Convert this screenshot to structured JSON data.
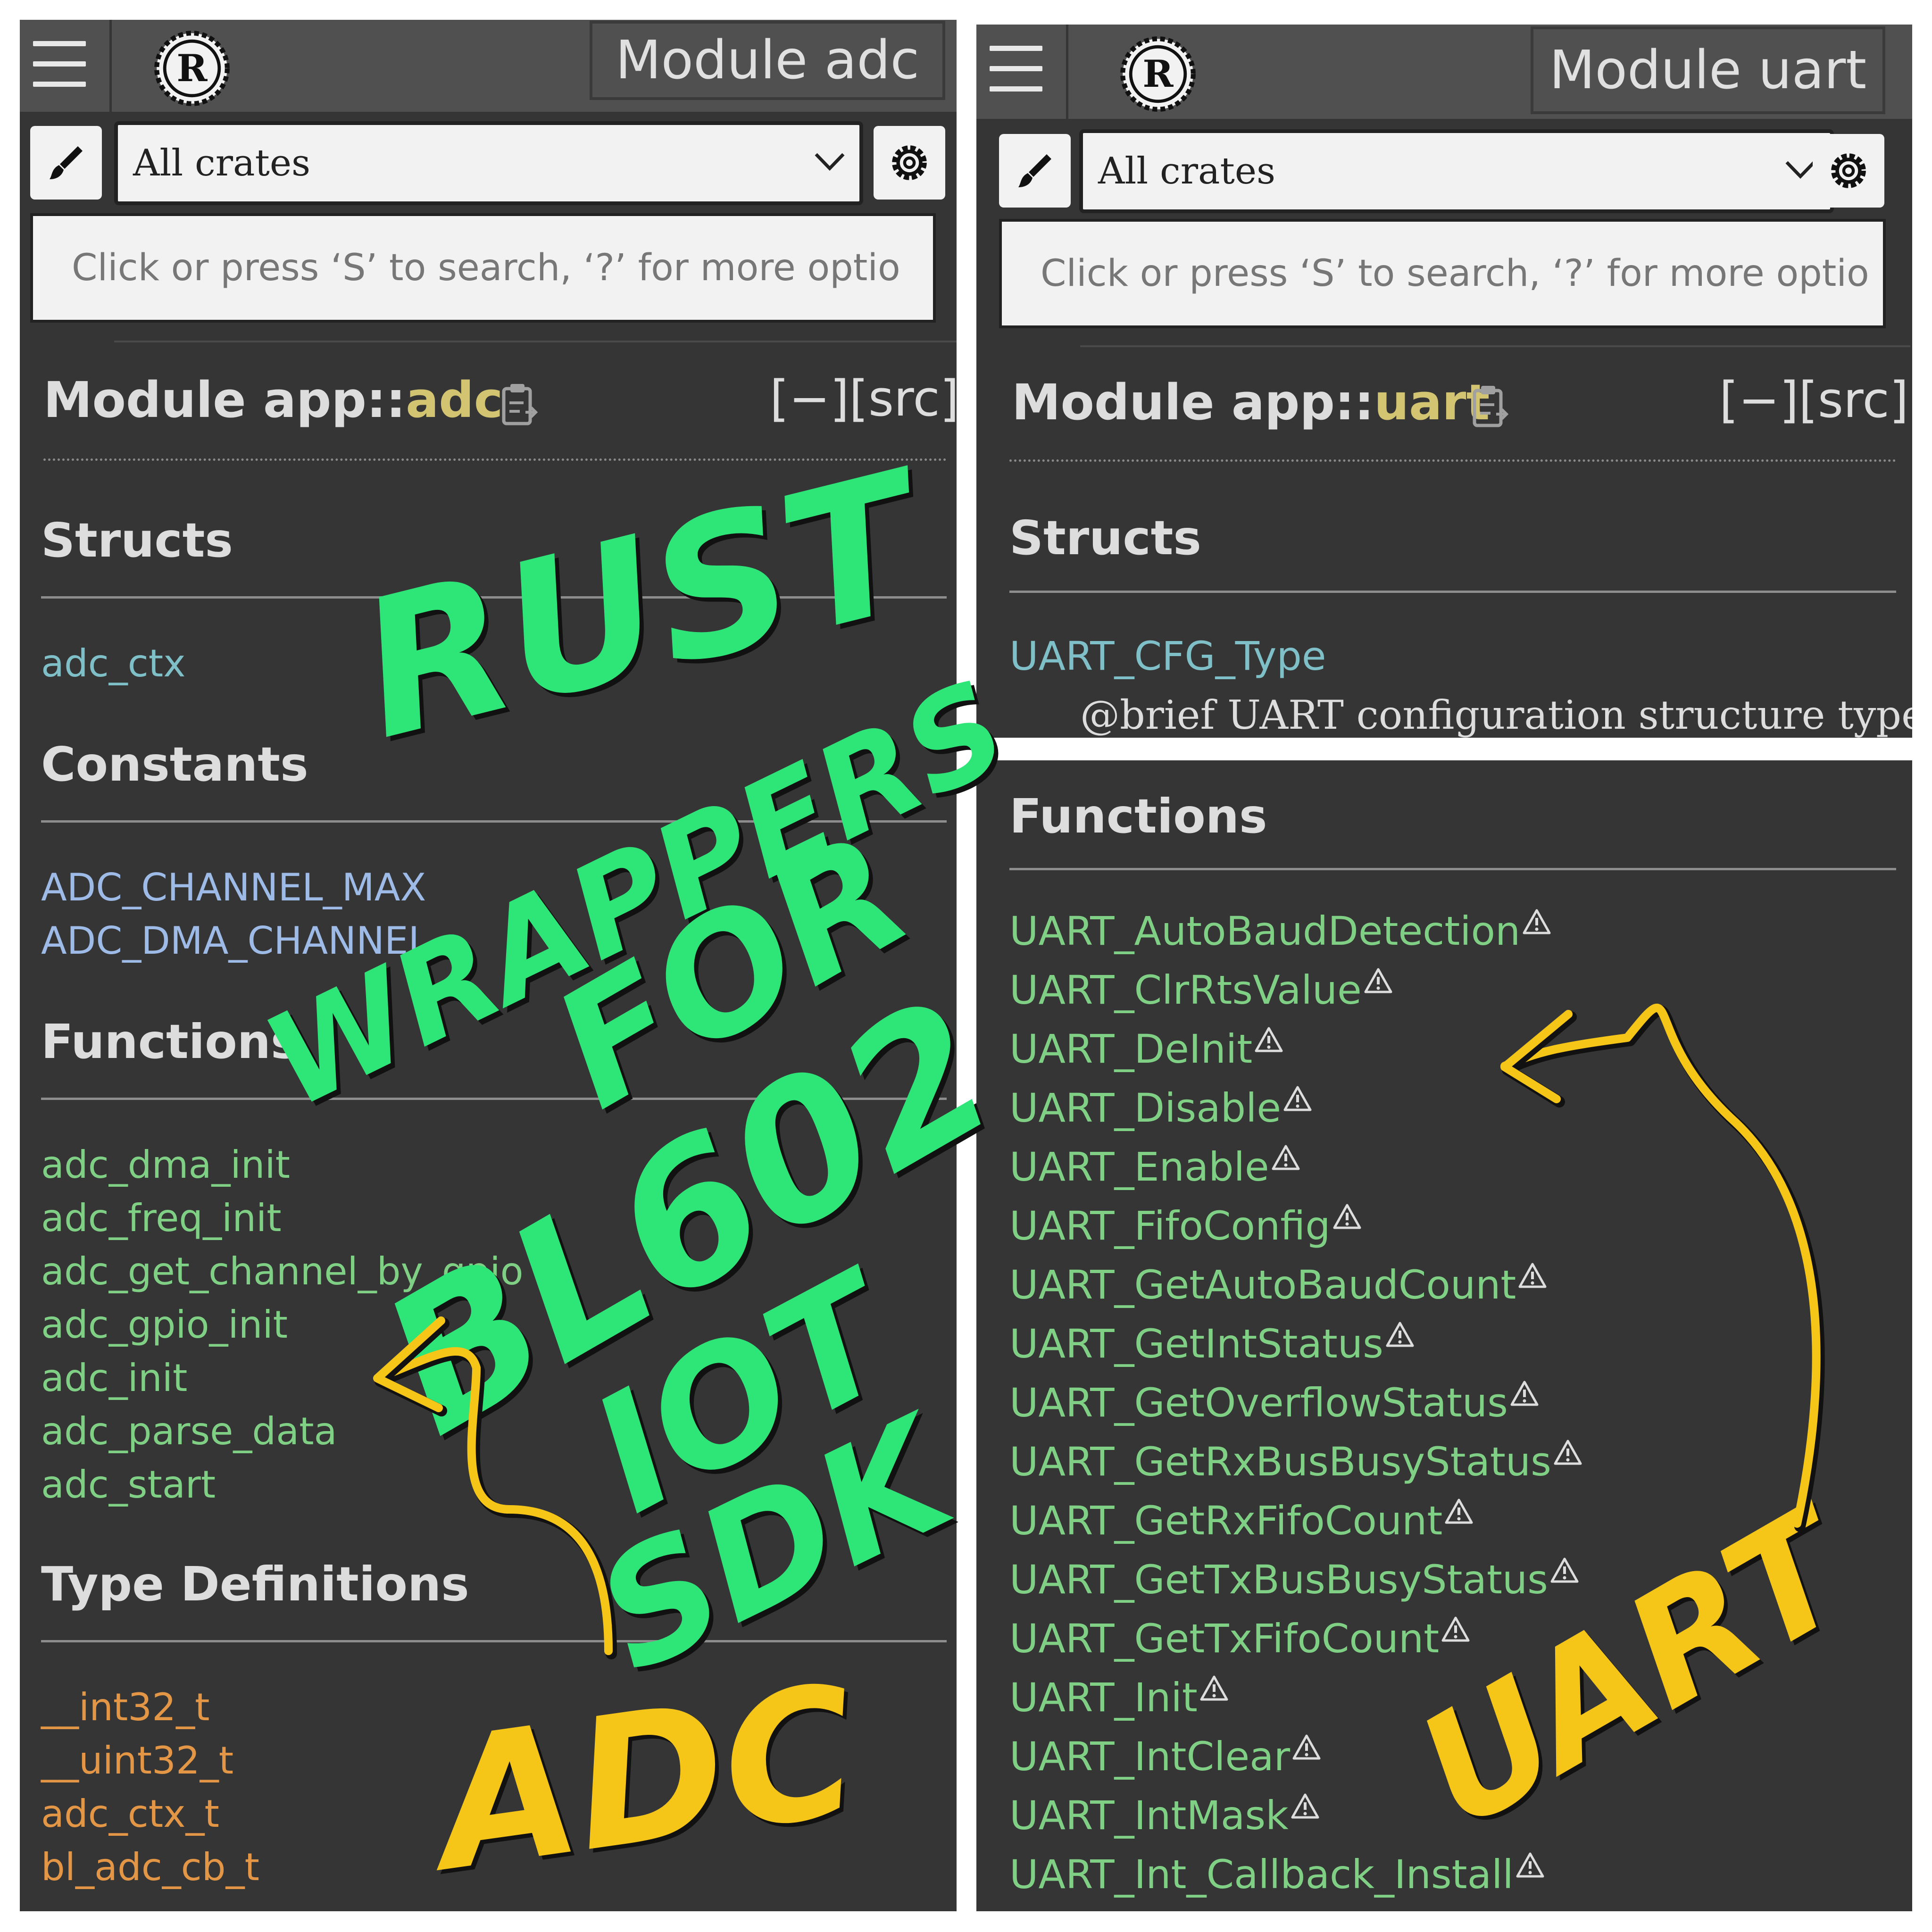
{
  "adc_panel": {
    "title_box": "Module adc",
    "crate_select": "All crates",
    "search_placeholder": "Click or press ‘S’ to search, ‘?’ for more optio",
    "heading_prefix": "Module app::",
    "heading_module": "adc",
    "src_links": "[−][src]",
    "sections": {
      "structs": {
        "title": "Structs",
        "items": [
          "adc_ctx"
        ]
      },
      "constants": {
        "title": "Constants",
        "items": [
          "ADC_CHANNEL_MAX",
          "ADC_DMA_CHANNEL"
        ]
      },
      "functions": {
        "title": "Functions",
        "items": [
          "adc_dma_init",
          "adc_freq_init",
          "adc_get_channel_by_gpio",
          "adc_gpio_init",
          "adc_init",
          "adc_parse_data",
          "adc_start"
        ]
      },
      "typedefs": {
        "title": "Type Definitions",
        "items": [
          "__int32_t",
          "__uint32_t",
          "adc_ctx_t",
          "bl_adc_cb_t"
        ]
      }
    }
  },
  "uart_panel": {
    "title_box": "Module uart",
    "crate_select": "All crates",
    "search_placeholder": "Click or press ‘S’ to search, ‘?’ for more optio",
    "heading_prefix": "Module app::",
    "heading_module": "uart",
    "src_links": "[−][src]",
    "structs": {
      "title": "Structs",
      "items": [
        {
          "name": "UART_CFG_Type",
          "doc": "@brief UART configuration structure type"
        }
      ]
    },
    "functions": {
      "title": "Functions",
      "items": [
        "UART_AutoBaudDetection",
        "UART_ClrRtsValue",
        "UART_DeInit",
        "UART_Disable",
        "UART_Enable",
        "UART_FifoConfig",
        "UART_GetAutoBaudCount",
        "UART_GetIntStatus",
        "UART_GetOverflowStatus",
        "UART_GetRxBusBusyStatus",
        "UART_GetRxFifoCount",
        "UART_GetTxBusBusyStatus",
        "UART_GetTxFifoCount",
        "UART_Init",
        "UART_IntClear",
        "UART_IntMask",
        "UART_Int_Callback_Install"
      ]
    }
  },
  "annotations": {
    "headline_lines": [
      "RUST",
      "WRAPPERS",
      "FOR",
      "BL602",
      "IOT",
      "SDK"
    ],
    "adc_label": "ADC",
    "uart_label": "UART",
    "headline_color": "#2ee577",
    "arrow_color": "#f5c518"
  },
  "colors": {
    "panel_bg": "#353535",
    "topbar_bg": "#505050",
    "module_name": "#d2c471",
    "struct_link": "#7fbfc7",
    "const_link": "#9dbbe6",
    "fn_link": "#7fcf84",
    "type_link": "#e39645"
  },
  "icons": [
    "hamburger-menu-icon",
    "rust-logo-icon",
    "paintbrush-icon",
    "chevron-down-icon",
    "gear-icon",
    "copy-path-icon",
    "warning-icon"
  ]
}
